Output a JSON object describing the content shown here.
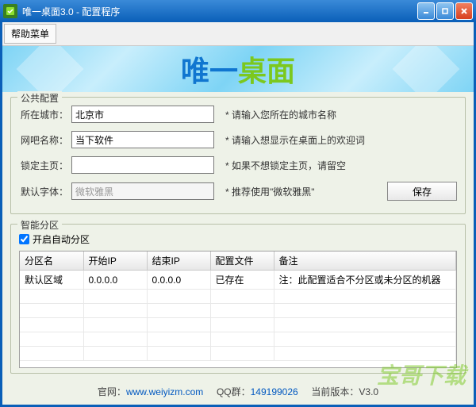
{
  "window": {
    "title": "唯一桌面3.0 - 配置程序"
  },
  "menu": {
    "help": "帮助菜单"
  },
  "banner": {
    "part1": "唯一",
    "part2": "桌面"
  },
  "publicConfig": {
    "legend": "公共配置",
    "cityLabel": "所在城市：",
    "cityValue": "北京市",
    "cityHint": "* 请输入您所在的城市名称",
    "barLabel": "网吧名称：",
    "barValue": "当下软件",
    "barHint": "* 请输入想显示在桌面上的欢迎词",
    "lockLabel": "锁定主页：",
    "lockValue": "",
    "lockHint": "* 如果不想锁定主页，请留空",
    "fontLabel": "默认字体：",
    "fontValue": "微软雅黑",
    "fontHint": "* 推荐使用\"微软雅黑\"",
    "saveLabel": "保存"
  },
  "smartZone": {
    "legend": "智能分区",
    "autoLabel": "开启自动分区",
    "columns": {
      "c0": "分区名",
      "c1": "开始IP",
      "c2": "结束IP",
      "c3": "配置文件",
      "c4": "备注"
    },
    "rows": [
      {
        "name": "默认区域",
        "startIp": "0.0.0.0",
        "endIp": "0.0.0.0",
        "config": "已存在",
        "remark": "注：此配置适合不分区或未分区的机器"
      }
    ]
  },
  "footer": {
    "siteLabel": "官网：",
    "siteUrl": "www.weiyizm.com",
    "qqLabel": "QQ群：",
    "qqNum": "149199026",
    "verLabel": "当前版本：",
    "verNum": "V3.0"
  },
  "watermark": "宝哥下载"
}
